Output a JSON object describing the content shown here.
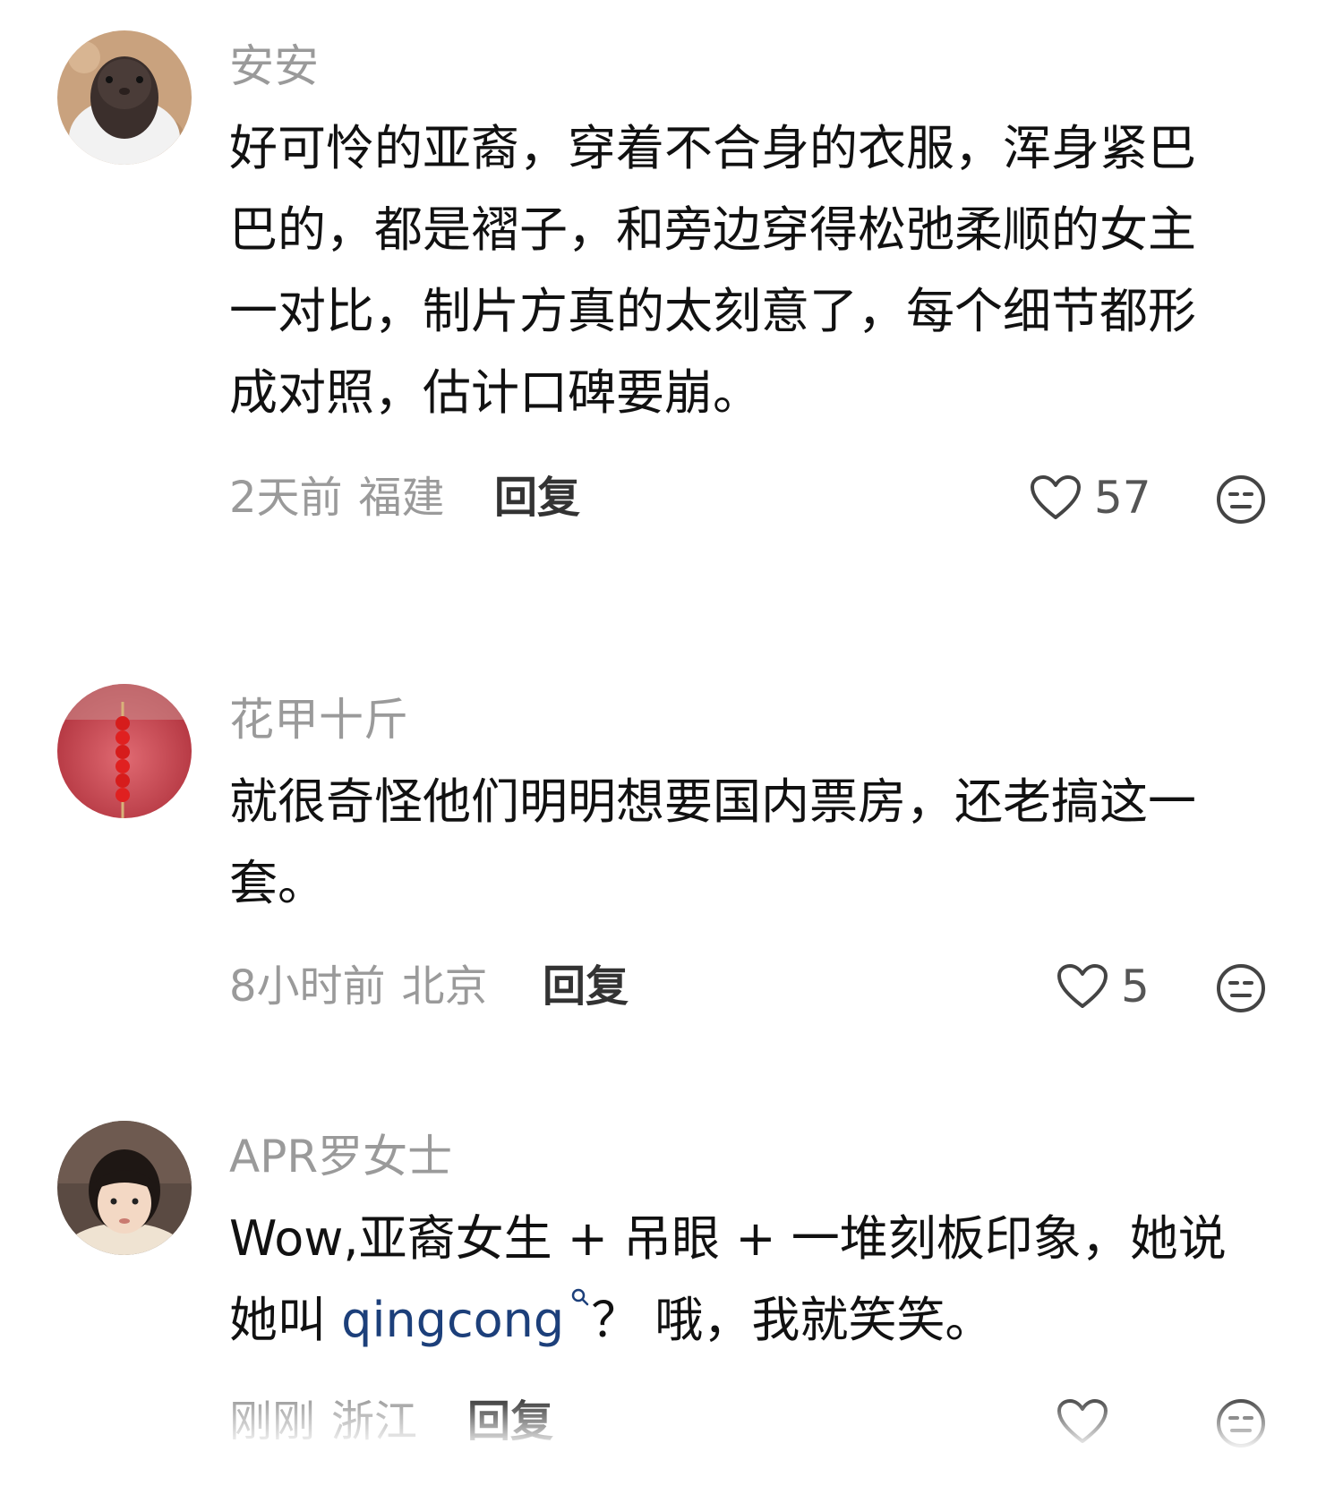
{
  "comments": [
    {
      "username": "安安",
      "avatar_icon": "pigeon-avatar",
      "lines": [
        "好可怜的亚裔，穿着不合身的衣服，浑身紧巴",
        "巴的，都是褶子，和旁边穿得松弛柔顺的女主",
        "一对比，制片方真的太刻意了，每个细节都形",
        "成对照，估计口碑要崩。"
      ],
      "time": "2天前",
      "location": "福建",
      "reply_label": "回复",
      "likes": "57"
    },
    {
      "username": "花甲十斤",
      "avatar_icon": "candied-haws-avatar",
      "lines": [
        "就很奇怪他们明明想要国内票房，还老搞这一",
        "套。"
      ],
      "time": "8小时前",
      "location": "北京",
      "reply_label": "回复",
      "likes": "5"
    },
    {
      "username": "APR罗女士",
      "avatar_icon": "child-photo-avatar",
      "line1": "Wow,亚裔女生 + 吊眼 + 一堆刻板印象，她说",
      "line2_before": "她叫 ",
      "line2_link": "qingcong",
      "line2_after": "？ 哦，我就笑笑。",
      "time": "刚刚",
      "location": "浙江",
      "reply_label": "回复",
      "likes": ""
    }
  ],
  "icons": {
    "like": "heart-outline-icon",
    "dislike": "neutral-face-icon",
    "link_search": "search-icon"
  },
  "colors": {
    "username": "#9a9a9a",
    "body": "#111111",
    "meta": "#9a9a9a",
    "reply": "#333333",
    "link": "#1c3f7a"
  }
}
